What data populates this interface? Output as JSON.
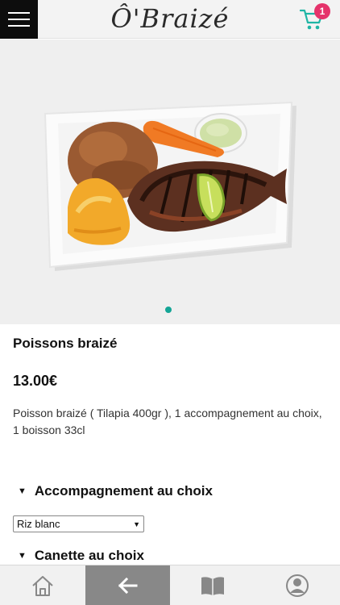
{
  "header": {
    "logo_text": "Ô'Braizé",
    "cart_count": "1"
  },
  "hero": {
    "image_alt": "Grilled tilapia with rice, plantain, carrot, lime and sauce",
    "carousel_dots": 1,
    "accent_color": "#14a596"
  },
  "product": {
    "title": "Poissons braizé",
    "price": "13.00€",
    "description": "Poisson braizé ( Tilapia 400gr ), 1 accompagnement au choix, 1 boisson 33cl"
  },
  "options": {
    "side_label": "Accompagnement au choix",
    "side_selected": "Riz blanc",
    "drink_label": "Canette au choix"
  },
  "bottom_nav": {
    "items": [
      "home-icon",
      "back-arrow-icon",
      "book-icon",
      "user-icon"
    ],
    "active": "back-arrow-icon"
  },
  "colors": {
    "badge": "#e5336b",
    "cart": "#1fb5a5",
    "active_nav": "#888888"
  }
}
